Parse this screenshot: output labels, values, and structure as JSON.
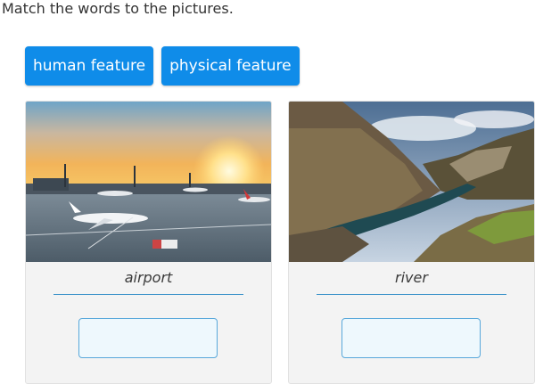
{
  "instruction": "Match the words to the pictures.",
  "word_bank": [
    {
      "label": "human feature"
    },
    {
      "label": "physical feature"
    }
  ],
  "cards": [
    {
      "caption": "airport",
      "image": "airport-photo",
      "answer": ""
    },
    {
      "caption": "river",
      "image": "river-canyon-photo",
      "answer": ""
    }
  ],
  "colors": {
    "chip": "#0f8ce9",
    "drop_border": "#58a8db",
    "drop_fill": "#eef8fd"
  }
}
